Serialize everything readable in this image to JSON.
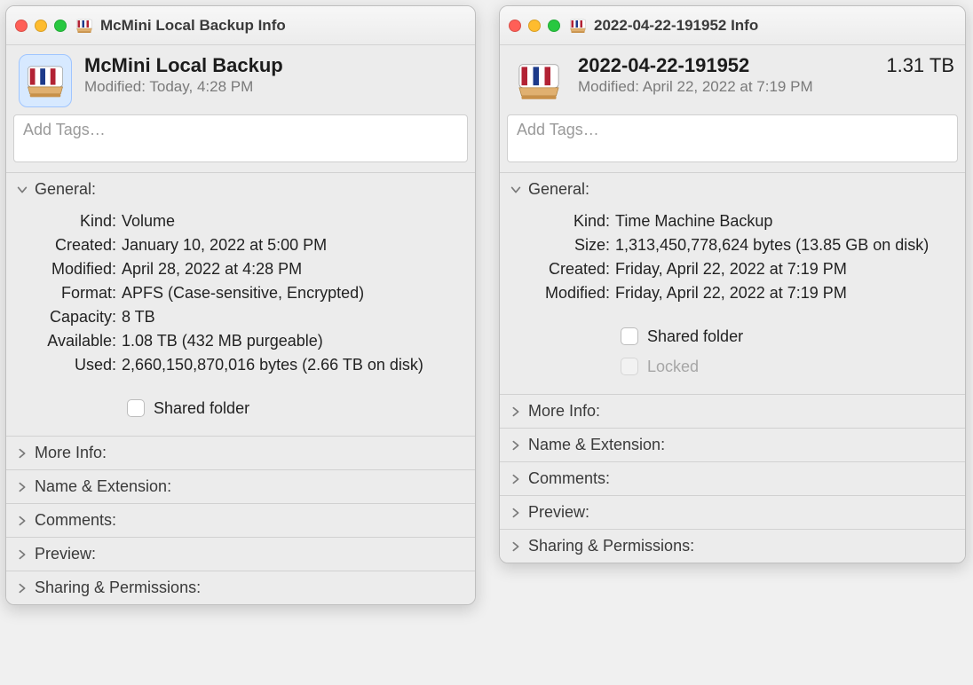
{
  "left": {
    "title": "McMini Local Backup Info",
    "name": "McMini Local Backup",
    "modified_header": "Modified: Today, 4:28 PM",
    "tags_placeholder": "Add Tags…",
    "general_label": "General:",
    "general": {
      "kind_k": "Kind:",
      "kind_v": "Volume",
      "created_k": "Created:",
      "created_v": "January 10, 2022 at 5:00 PM",
      "modified_k": "Modified:",
      "modified_v": "April 28, 2022 at 4:28 PM",
      "format_k": "Format:",
      "format_v": "APFS (Case-sensitive, Encrypted)",
      "capacity_k": "Capacity:",
      "capacity_v": "8 TB",
      "available_k": "Available:",
      "available_v": "1.08 TB (432 MB purgeable)",
      "used_k": "Used:",
      "used_v": "2,660,150,870,016 bytes (2.66 TB on disk)"
    },
    "shared_folder": "Shared folder",
    "sections": {
      "more_info": "More Info:",
      "name_ext": "Name & Extension:",
      "comments": "Comments:",
      "preview": "Preview:",
      "sharing": "Sharing & Permissions:"
    }
  },
  "right": {
    "title": "2022-04-22-191952 Info",
    "name": "2022-04-22-191952",
    "size": "1.31 TB",
    "modified_header": "Modified: April 22, 2022 at 7:19 PM",
    "tags_placeholder": "Add Tags…",
    "general_label": "General:",
    "general": {
      "kind_k": "Kind:",
      "kind_v": "Time Machine Backup",
      "size_k": "Size:",
      "size_v": "1,313,450,778,624 bytes (13.85 GB on disk)",
      "created_k": "Created:",
      "created_v": "Friday, April 22, 2022 at 7:19 PM",
      "modified_k": "Modified:",
      "modified_v": "Friday, April 22, 2022 at 7:19 PM"
    },
    "shared_folder": "Shared folder",
    "locked": "Locked",
    "sections": {
      "more_info": "More Info:",
      "name_ext": "Name & Extension:",
      "comments": "Comments:",
      "preview": "Preview:",
      "sharing": "Sharing & Permissions:"
    }
  }
}
